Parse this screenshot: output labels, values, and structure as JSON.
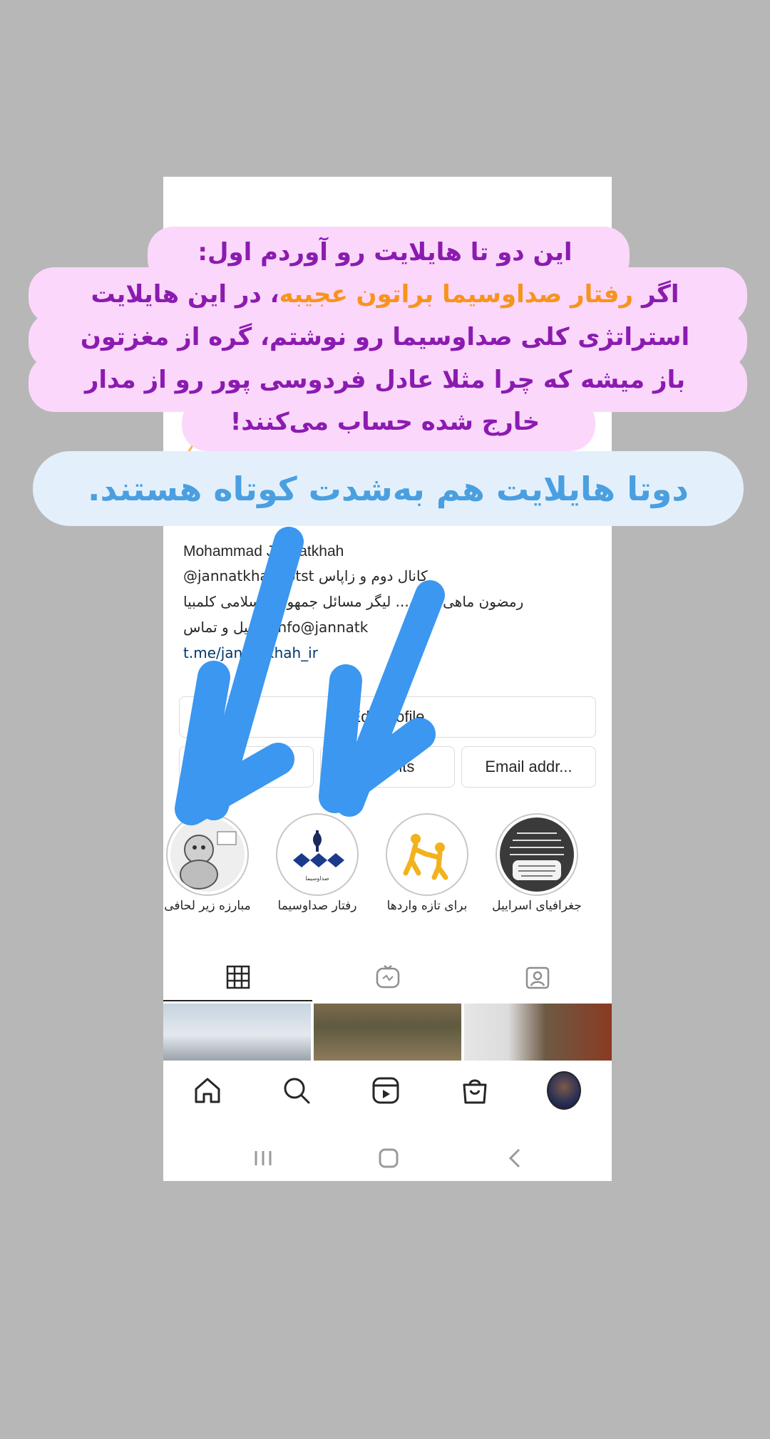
{
  "profile": {
    "name": "Mohammad Jannatkhah",
    "bio_line1": "@jannatkhahdotst کانال دوم و زاپاس",
    "bio_line2": "رمضون ماهی مغرو... لیگر مسائل جمهوری اسلامی کلمبیا",
    "bio_line3": "ایمیل و تماس: info@jannatk",
    "link": "t.me/jannatkhah_ir"
  },
  "buttons": {
    "edit_profile": "Edit profile",
    "promotions": "Promotions",
    "insights": "Insights",
    "email": "Email addr..."
  },
  "highlights": [
    {
      "label": "مبارزه زیر لحافی",
      "icon": "cartoon-icon"
    },
    {
      "label": "رفتار صداوسیما",
      "icon": "irib-logo-icon"
    },
    {
      "label": "برای تازه واردها",
      "icon": "helping-hand-icon"
    },
    {
      "label": "جغرافیای اسراییل",
      "icon": "text-image-icon"
    }
  ],
  "tabs": [
    "grid",
    "reels",
    "tagged"
  ],
  "bottom_nav": [
    "home",
    "search",
    "reels",
    "shop",
    "profile"
  ],
  "caption": {
    "line1": "این دو تا هایلایت رو آوردم اول:",
    "line2_prefix": "اگر ",
    "line2_highlight": "رفتار صداوسیما براتون عجیبه",
    "line2_suffix": "، در این هایلایت",
    "line3": "استراتژی کلی صداوسیما رو نوشتم، گره از مغزتون",
    "line4": "باز میشه که چرا مثلا عادل فردوسی پور رو از مدار",
    "line5": "خارج شده حساب می‌کنند!"
  },
  "note": "دوتا هایلایت هم به‌شدت کوتاه هستند.",
  "colors": {
    "bubble_pink": "#fbd7fb",
    "caption_purple": "#8b1bb0",
    "caption_orange": "#f7941d",
    "arrow_blue": "#3b97ef",
    "note_blue": "#4a9fe0"
  }
}
